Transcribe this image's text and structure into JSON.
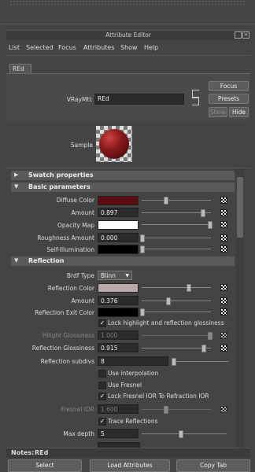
{
  "window": {
    "title": "Attribute Editor"
  },
  "menu": [
    "List",
    "Selected",
    "Focus",
    "Attributes",
    "Show",
    "Help"
  ],
  "tab": {
    "label": "REd"
  },
  "header": {
    "node_label": "VRayMtl:",
    "node_value": "REd",
    "focus_label": "Focus",
    "presets_label": "Presets",
    "show_label": "Show",
    "hide_label": "Hide",
    "sample_label": "Sample"
  },
  "sections": {
    "swatch": "Swatch properties",
    "basic": "Basic parameters",
    "reflection": "Reflection"
  },
  "basic": {
    "diffuse_label": "Diffuse Color",
    "diffuse_color": "#5c0c10",
    "amount_label": "Amount",
    "amount_value": "0.897",
    "opacity_label": "Opacity Map",
    "opacity_color": "#ffffff",
    "roughness_label": "Roughness Amount",
    "roughness_value": "0.000",
    "selfillum_label": "Self-Illumination",
    "selfillum_color": "#000000"
  },
  "reflection": {
    "brdf_label": "Brdf Type",
    "brdf_value": "Blinn",
    "refl_color_label": "Reflection Color",
    "refl_color": "#b9a8aa",
    "amount_label": "Amount",
    "amount_value": "0.376",
    "exit_label": "Reflection Exit Color",
    "exit_color": "#000000",
    "lock_hl_label": "Lock highlight and reflection glossiness",
    "hilight_label": "Hilight Glossiness",
    "hilight_value": "1.000",
    "gloss_label": "Reflection Glossiness",
    "gloss_value": "0.915",
    "subdivs_label": "Reflection subdivs",
    "subdivs_value": "8",
    "use_interp_label": "Use interpolation",
    "use_fresnel_label": "Use Fresnel",
    "lock_fresnel_label": "Lock Fresnel IOR To Refraction IOR",
    "fresnel_ior_label": "Fresnel IOR",
    "fresnel_ior_value": "1.600",
    "trace_label": "Trace Reflections",
    "maxdepth_label": "Max depth",
    "maxdepth_value": "5"
  },
  "notes": {
    "label": "Notes:",
    "value": "REd"
  },
  "bottom": {
    "select": "Select",
    "load": "Load Attributes",
    "copy": "Copy Tab"
  }
}
